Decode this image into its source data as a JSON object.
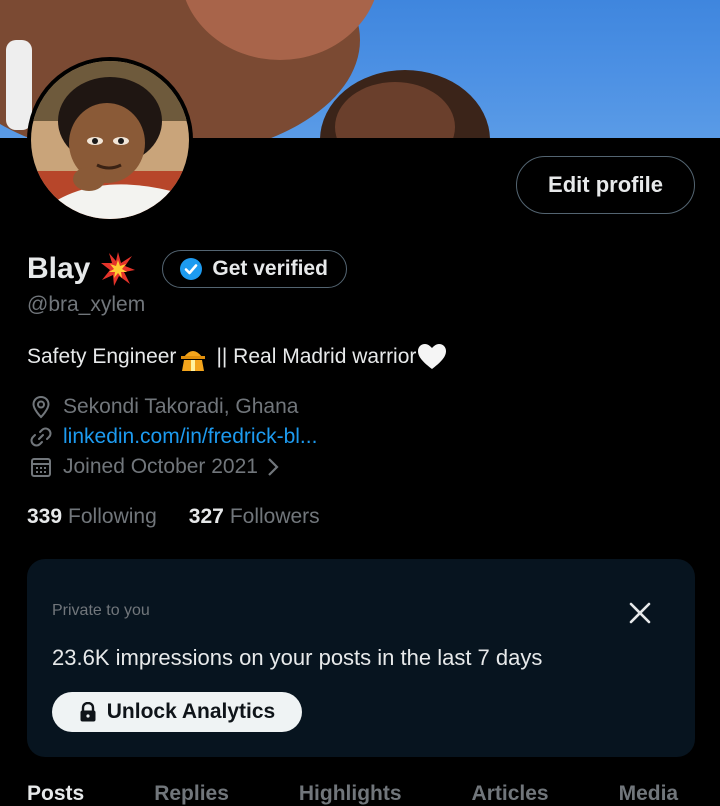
{
  "profile": {
    "name": "Blay",
    "handle": "@bra_xylem",
    "edit_label": "Edit profile",
    "verify_label": "Get verified",
    "bio_part1": "Safety Engineer",
    "bio_part2": "|| Real Madrid warrior",
    "location": "Sekondi Takoradi, Ghana",
    "website": "linkedin.com/in/fredrick-bl...",
    "joined": "Joined October 2021",
    "following_count": "339",
    "following_label": "Following",
    "followers_count": "327",
    "followers_label": "Followers"
  },
  "analytics_card": {
    "private_label": "Private to you",
    "impressions_text": "23.6K impressions on your posts in the last 7 days",
    "unlock_label": "Unlock Analytics"
  },
  "tabs": [
    "Posts",
    "Replies",
    "Highlights",
    "Articles",
    "Media"
  ],
  "icons": {
    "name_emoji": "collision-emoji",
    "verify": "verified-badge-icon",
    "bio_emoji": "construction-worker-emoji",
    "bio_heart": "white-heart-emoji",
    "location": "location-pin-icon",
    "website": "link-icon",
    "joined": "calendar-icon",
    "close": "close-icon",
    "lock": "lock-icon"
  },
  "colors": {
    "background": "#000000",
    "text": "#e7e9ea",
    "muted": "#71767b",
    "link": "#1d9bf0",
    "card": "#07141f",
    "button_light": "#eff3f4"
  }
}
